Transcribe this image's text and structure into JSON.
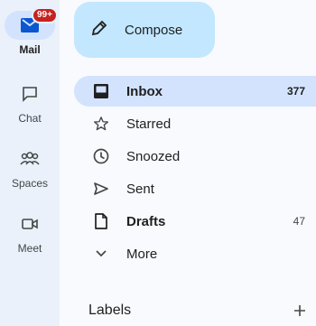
{
  "rail": {
    "items": [
      {
        "label": "Mail",
        "icon": "mail-icon",
        "active": true,
        "badge": "99+"
      },
      {
        "label": "Chat",
        "icon": "chat-icon"
      },
      {
        "label": "Spaces",
        "icon": "spaces-icon"
      },
      {
        "label": "Meet",
        "icon": "meet-icon"
      }
    ]
  },
  "compose": {
    "label": "Compose",
    "icon": "pencil-icon"
  },
  "folders": [
    {
      "name": "Inbox",
      "count": "377",
      "icon": "inbox-icon",
      "active": true,
      "bold": true
    },
    {
      "name": "Starred",
      "count": "",
      "icon": "star-icon"
    },
    {
      "name": "Snoozed",
      "count": "",
      "icon": "clock-icon"
    },
    {
      "name": "Sent",
      "count": "",
      "icon": "send-icon"
    },
    {
      "name": "Drafts",
      "count": "47",
      "icon": "draft-icon",
      "bold": true
    },
    {
      "name": "More",
      "count": "",
      "icon": "chevron-down-icon"
    }
  ],
  "labels": {
    "title": "Labels",
    "add_icon": "plus-icon"
  },
  "colors": {
    "rail_bg": "#eaf1fb",
    "compose_bg": "#c2e7ff",
    "active_bg": "#d3e3fd",
    "badge": "#c5221f"
  }
}
